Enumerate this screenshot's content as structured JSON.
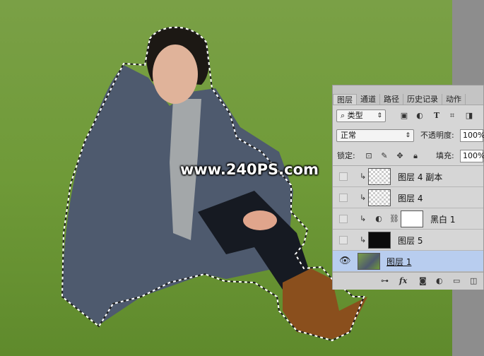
{
  "watermark": "www.240PS.com",
  "panel": {
    "tabs": [
      "图层",
      "通道",
      "路径",
      "历史记录",
      "动作"
    ],
    "active_tab": "图层",
    "filter": {
      "type_label": "类型",
      "icons": [
        "image-filter-icon",
        "adjustment-filter-icon",
        "text-filter-icon",
        "shape-filter-icon",
        "smart-object-filter-icon"
      ]
    },
    "blend_mode": "正常",
    "opacity_label": "不透明度:",
    "opacity_value": "100%",
    "lock_label": "锁定:",
    "fill_label": "填充:",
    "fill_value": "100%",
    "layers": [
      {
        "name": "图层 4 副本",
        "visible": false,
        "clipped": true,
        "thumb": "checker-smart"
      },
      {
        "name": "图层 4",
        "visible": false,
        "clipped": true,
        "thumb": "checker-smart"
      },
      {
        "name": "黑白 1",
        "visible": false,
        "clipped": true,
        "thumb": "adjustment"
      },
      {
        "name": "图层 5",
        "visible": false,
        "clipped": true,
        "thumb": "dark-photo"
      },
      {
        "name": "图层 1",
        "visible": true,
        "clipped": false,
        "thumb": "photo",
        "selected": true
      }
    ],
    "footer_icons": [
      "link-icon",
      "fx-icon",
      "mask-icon",
      "adjustment-icon",
      "folder-icon",
      "new-layer-icon"
    ]
  }
}
